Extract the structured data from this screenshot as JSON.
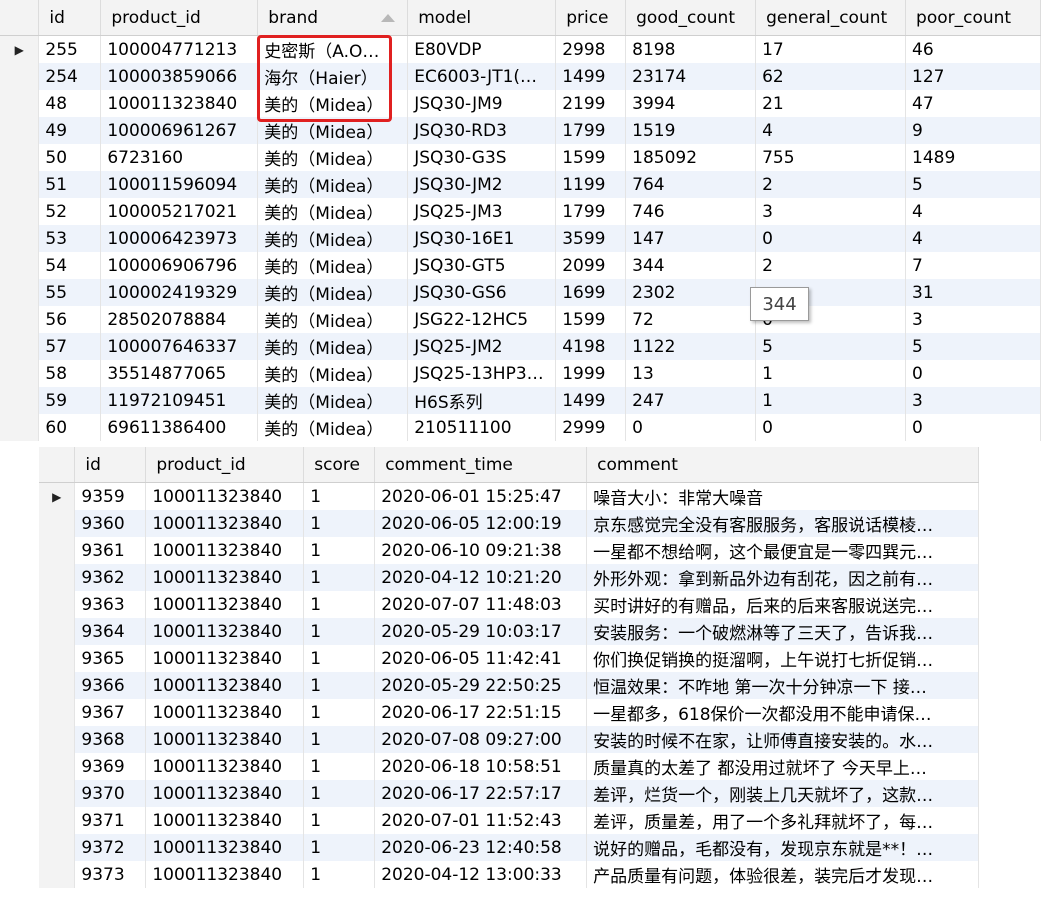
{
  "products": {
    "columns": [
      "id",
      "product_id",
      "brand",
      "model",
      "price",
      "good_count",
      "general_count",
      "poor_count"
    ],
    "sorted_column": "brand",
    "rows": [
      [
        "255",
        "100004771213",
        "史密斯（A.O…",
        "E80VDP",
        "2998",
        "8198",
        "17",
        "46"
      ],
      [
        "254",
        "100003859066",
        "海尔（Haier）",
        "EC6003-JT1(…",
        "1499",
        "23174",
        "62",
        "127"
      ],
      [
        "48",
        "100011323840",
        "美的（Midea）",
        "JSQ30-JM9",
        "2199",
        "3994",
        "21",
        "47"
      ],
      [
        "49",
        "100006961267",
        "美的（Midea）",
        "JSQ30-RD3",
        "1799",
        "1519",
        "4",
        "9"
      ],
      [
        "50",
        "6723160",
        "美的（Midea）",
        "JSQ30-G3S",
        "1599",
        "185092",
        "755",
        "1489"
      ],
      [
        "51",
        "100011596094",
        "美的（Midea）",
        "JSQ30-JM2",
        "1199",
        "764",
        "2",
        "5"
      ],
      [
        "52",
        "100005217021",
        "美的（Midea）",
        "JSQ25-JM3",
        "1799",
        "746",
        "3",
        "4"
      ],
      [
        "53",
        "100006423973",
        "美的（Midea）",
        "JSQ30-16E1",
        "3599",
        "147",
        "0",
        "4"
      ],
      [
        "54",
        "100006906796",
        "美的（Midea）",
        "JSQ30-GT5",
        "2099",
        "344",
        "2",
        "7"
      ],
      [
        "55",
        "100002419329",
        "美的（Midea）",
        "JSQ30-GS6",
        "1699",
        "2302",
        "",
        "31"
      ],
      [
        "56",
        "28502078884",
        "美的（Midea）",
        "JSG22-12HC5",
        "1599",
        "72",
        "0",
        "3"
      ],
      [
        "57",
        "100007646337",
        "美的（Midea）",
        "JSQ25-JM2",
        "4198",
        "1122",
        "5",
        "5"
      ],
      [
        "58",
        "35514877065",
        "美的（Midea）",
        "JSQ25-13HP3…",
        "1999",
        "13",
        "1",
        "0"
      ],
      [
        "59",
        "11972109451",
        "美的（Midea）",
        "H6S系列",
        "1499",
        "247",
        "1",
        "3"
      ],
      [
        "60",
        "69611386400",
        "美的（Midea）",
        "210511100",
        "2999",
        "0",
        "0",
        "0"
      ]
    ],
    "tooltip": "344"
  },
  "comments": {
    "columns": [
      "id",
      "product_id",
      "score",
      "comment_time",
      "comment"
    ],
    "rows": [
      [
        "9359",
        "100011323840",
        "1",
        "2020-06-01 15:25:47",
        "噪音大小：非常大噪音"
      ],
      [
        "9360",
        "100011323840",
        "1",
        "2020-06-05 12:00:19",
        "京东感觉完全没有客服服务，客服说话模棱…"
      ],
      [
        "9361",
        "100011323840",
        "1",
        "2020-06-10 09:21:38",
        "一星都不想给啊，这个最便宜是一零四巽元…"
      ],
      [
        "9362",
        "100011323840",
        "1",
        "2020-04-12 10:21:20",
        "外形外观：拿到新品外边有刮花，因之前有…"
      ],
      [
        "9363",
        "100011323840",
        "1",
        "2020-07-07 11:48:03",
        "买时讲好的有赠品，后来的后来客服说送完…"
      ],
      [
        "9364",
        "100011323840",
        "1",
        "2020-05-29 10:03:17",
        "安装服务：一个破燃淋等了三天了，告诉我…"
      ],
      [
        "9365",
        "100011323840",
        "1",
        "2020-06-05 11:42:41",
        "你们换促销换的挺溜啊，上午说打七折促销…"
      ],
      [
        "9366",
        "100011323840",
        "1",
        "2020-05-29 22:50:25",
        "恒温效果：不咋地 第一次十分钟凉一下 接…"
      ],
      [
        "9367",
        "100011323840",
        "1",
        "2020-06-17 22:51:15",
        "一星都多，618保价一次都没用不能申请保…"
      ],
      [
        "9368",
        "100011323840",
        "1",
        "2020-07-08 09:27:00",
        "安装的时候不在家，让师傅直接安装的。水…"
      ],
      [
        "9369",
        "100011323840",
        "1",
        "2020-06-18 10:58:51",
        "质量真的太差了 都没用过就坏了 今天早上…"
      ],
      [
        "9370",
        "100011323840",
        "1",
        "2020-06-17 22:57:17",
        "差评，烂货一个，刚装上几天就坏了，这款…"
      ],
      [
        "9371",
        "100011323840",
        "1",
        "2020-07-01 11:52:43",
        "差评，质量差，用了一个多礼拜就坏了，每…"
      ],
      [
        "9372",
        "100011323840",
        "1",
        "2020-06-23 12:40:58",
        "说好的赠品，毛都没有，发现京东就是**！…"
      ],
      [
        "9373",
        "100011323840",
        "1",
        "2020-04-12 13:00:33",
        "产品质量有问题，体验很差，装完后才发现…"
      ]
    ]
  },
  "icons": {
    "current_row": "row-pointer-icon",
    "sort": "sort-ascending-icon"
  },
  "colors": {
    "highlight": "#e02020",
    "alt_row": "#eef3fb",
    "header": "#f3f3f3"
  }
}
